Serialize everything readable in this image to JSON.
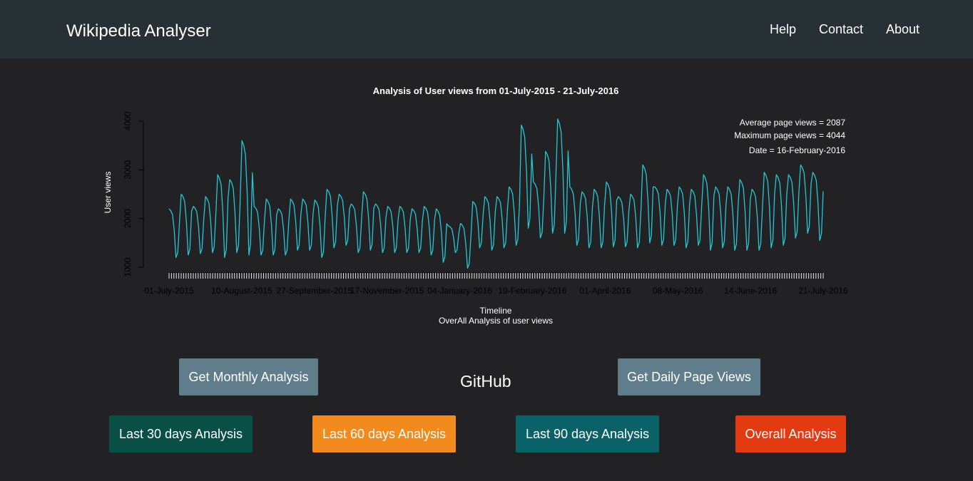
{
  "navbar": {
    "brand": "Wikipedia Analyser",
    "links": [
      "Help",
      "Contact",
      "About"
    ]
  },
  "actions": {
    "monthly": "Get Monthly Analysis",
    "github": "GitHub",
    "daily": "Get Daily Page Views",
    "last30": "Last 30 days Analysis",
    "last60": "Last 60 days Analysis",
    "last90": "Last 90 days Analysis",
    "overall": "Overall Analysis"
  },
  "colors": {
    "navbar_bg": "#263035",
    "page_bg": "#222123",
    "line": "#22c8d6",
    "btn_slate": "#607d8b",
    "btn_dark_green": "#0a4f45",
    "btn_orange": "#f28a1e",
    "btn_teal": "#0a6268",
    "btn_red": "#e43a12"
  },
  "chart_data": {
    "type": "line",
    "title": "Analysis of User views from 01-July-2015 - 21-July-2016",
    "xlabel": "Timeline",
    "subtitle": "OverAll Analysis of user views",
    "ylabel": "User views",
    "ylim": [
      1000,
      4000
    ],
    "yticks": [
      1000,
      2000,
      3000,
      4000
    ],
    "x_tick_labels": [
      "01-July-2015",
      "10-August-2015",
      "27-September-2015",
      "17-November-2015",
      "04-January-2016",
      "19-February-2016",
      "01-April-2016",
      "08-May-2016",
      "14-June-2016",
      "21-July-2016"
    ],
    "annotations": [
      "Average page views = 2087",
      "Maximum page views = 4044",
      "Date = 16-February-2016"
    ],
    "series": [
      {
        "weekly_anchors": [
          [
            2200,
            1200
          ],
          [
            2500,
            1250
          ],
          [
            2250,
            1280
          ],
          [
            2450,
            1300
          ],
          [
            2900,
            1200
          ],
          [
            2800,
            1300
          ],
          [
            3600,
            1250
          ],
          [
            2250,
            1250
          ],
          [
            2400,
            1250
          ],
          [
            2200,
            1250
          ],
          [
            2400,
            1350
          ],
          [
            2400,
            1350
          ],
          [
            2380,
            1200
          ],
          [
            2600,
            1400
          ],
          [
            2500,
            1450
          ],
          [
            2300,
            1300
          ],
          [
            2550,
            1350
          ],
          [
            2300,
            1300
          ],
          [
            2250,
            1300
          ],
          [
            2250,
            1300
          ],
          [
            2200,
            1300
          ],
          [
            2250,
            1250
          ],
          [
            2200,
            1100
          ],
          [
            1850,
            1300
          ],
          [
            1900,
            980
          ],
          [
            2350,
            1400
          ],
          [
            2450,
            1350
          ],
          [
            2450,
            1400
          ],
          [
            2650,
            1450
          ],
          [
            3920,
            1800
          ],
          [
            2750,
            1600
          ],
          [
            3380,
            1700
          ],
          [
            4044,
            1700
          ],
          [
            2650,
            1450
          ],
          [
            2550,
            1400
          ],
          [
            2600,
            1400
          ],
          [
            2750,
            1420
          ],
          [
            2450,
            1420
          ],
          [
            2500,
            1400
          ],
          [
            3100,
            1500
          ],
          [
            2650,
            1450
          ],
          [
            2600,
            1450
          ],
          [
            2650,
            1400
          ],
          [
            2600,
            1450
          ],
          [
            2900,
            1350
          ],
          [
            2650,
            1400
          ],
          [
            2650,
            1350
          ],
          [
            2800,
            1350
          ],
          [
            2600,
            1350
          ],
          [
            2950,
            1400
          ],
          [
            2900,
            1450
          ],
          [
            2900,
            1600
          ],
          [
            3100,
            1700
          ],
          [
            2950,
            1550
          ]
        ],
        "weekday_factors": [
          1.0,
          0.96,
          0.88,
          0.55,
          0.0,
          0.1,
          0.72
        ]
      }
    ]
  }
}
